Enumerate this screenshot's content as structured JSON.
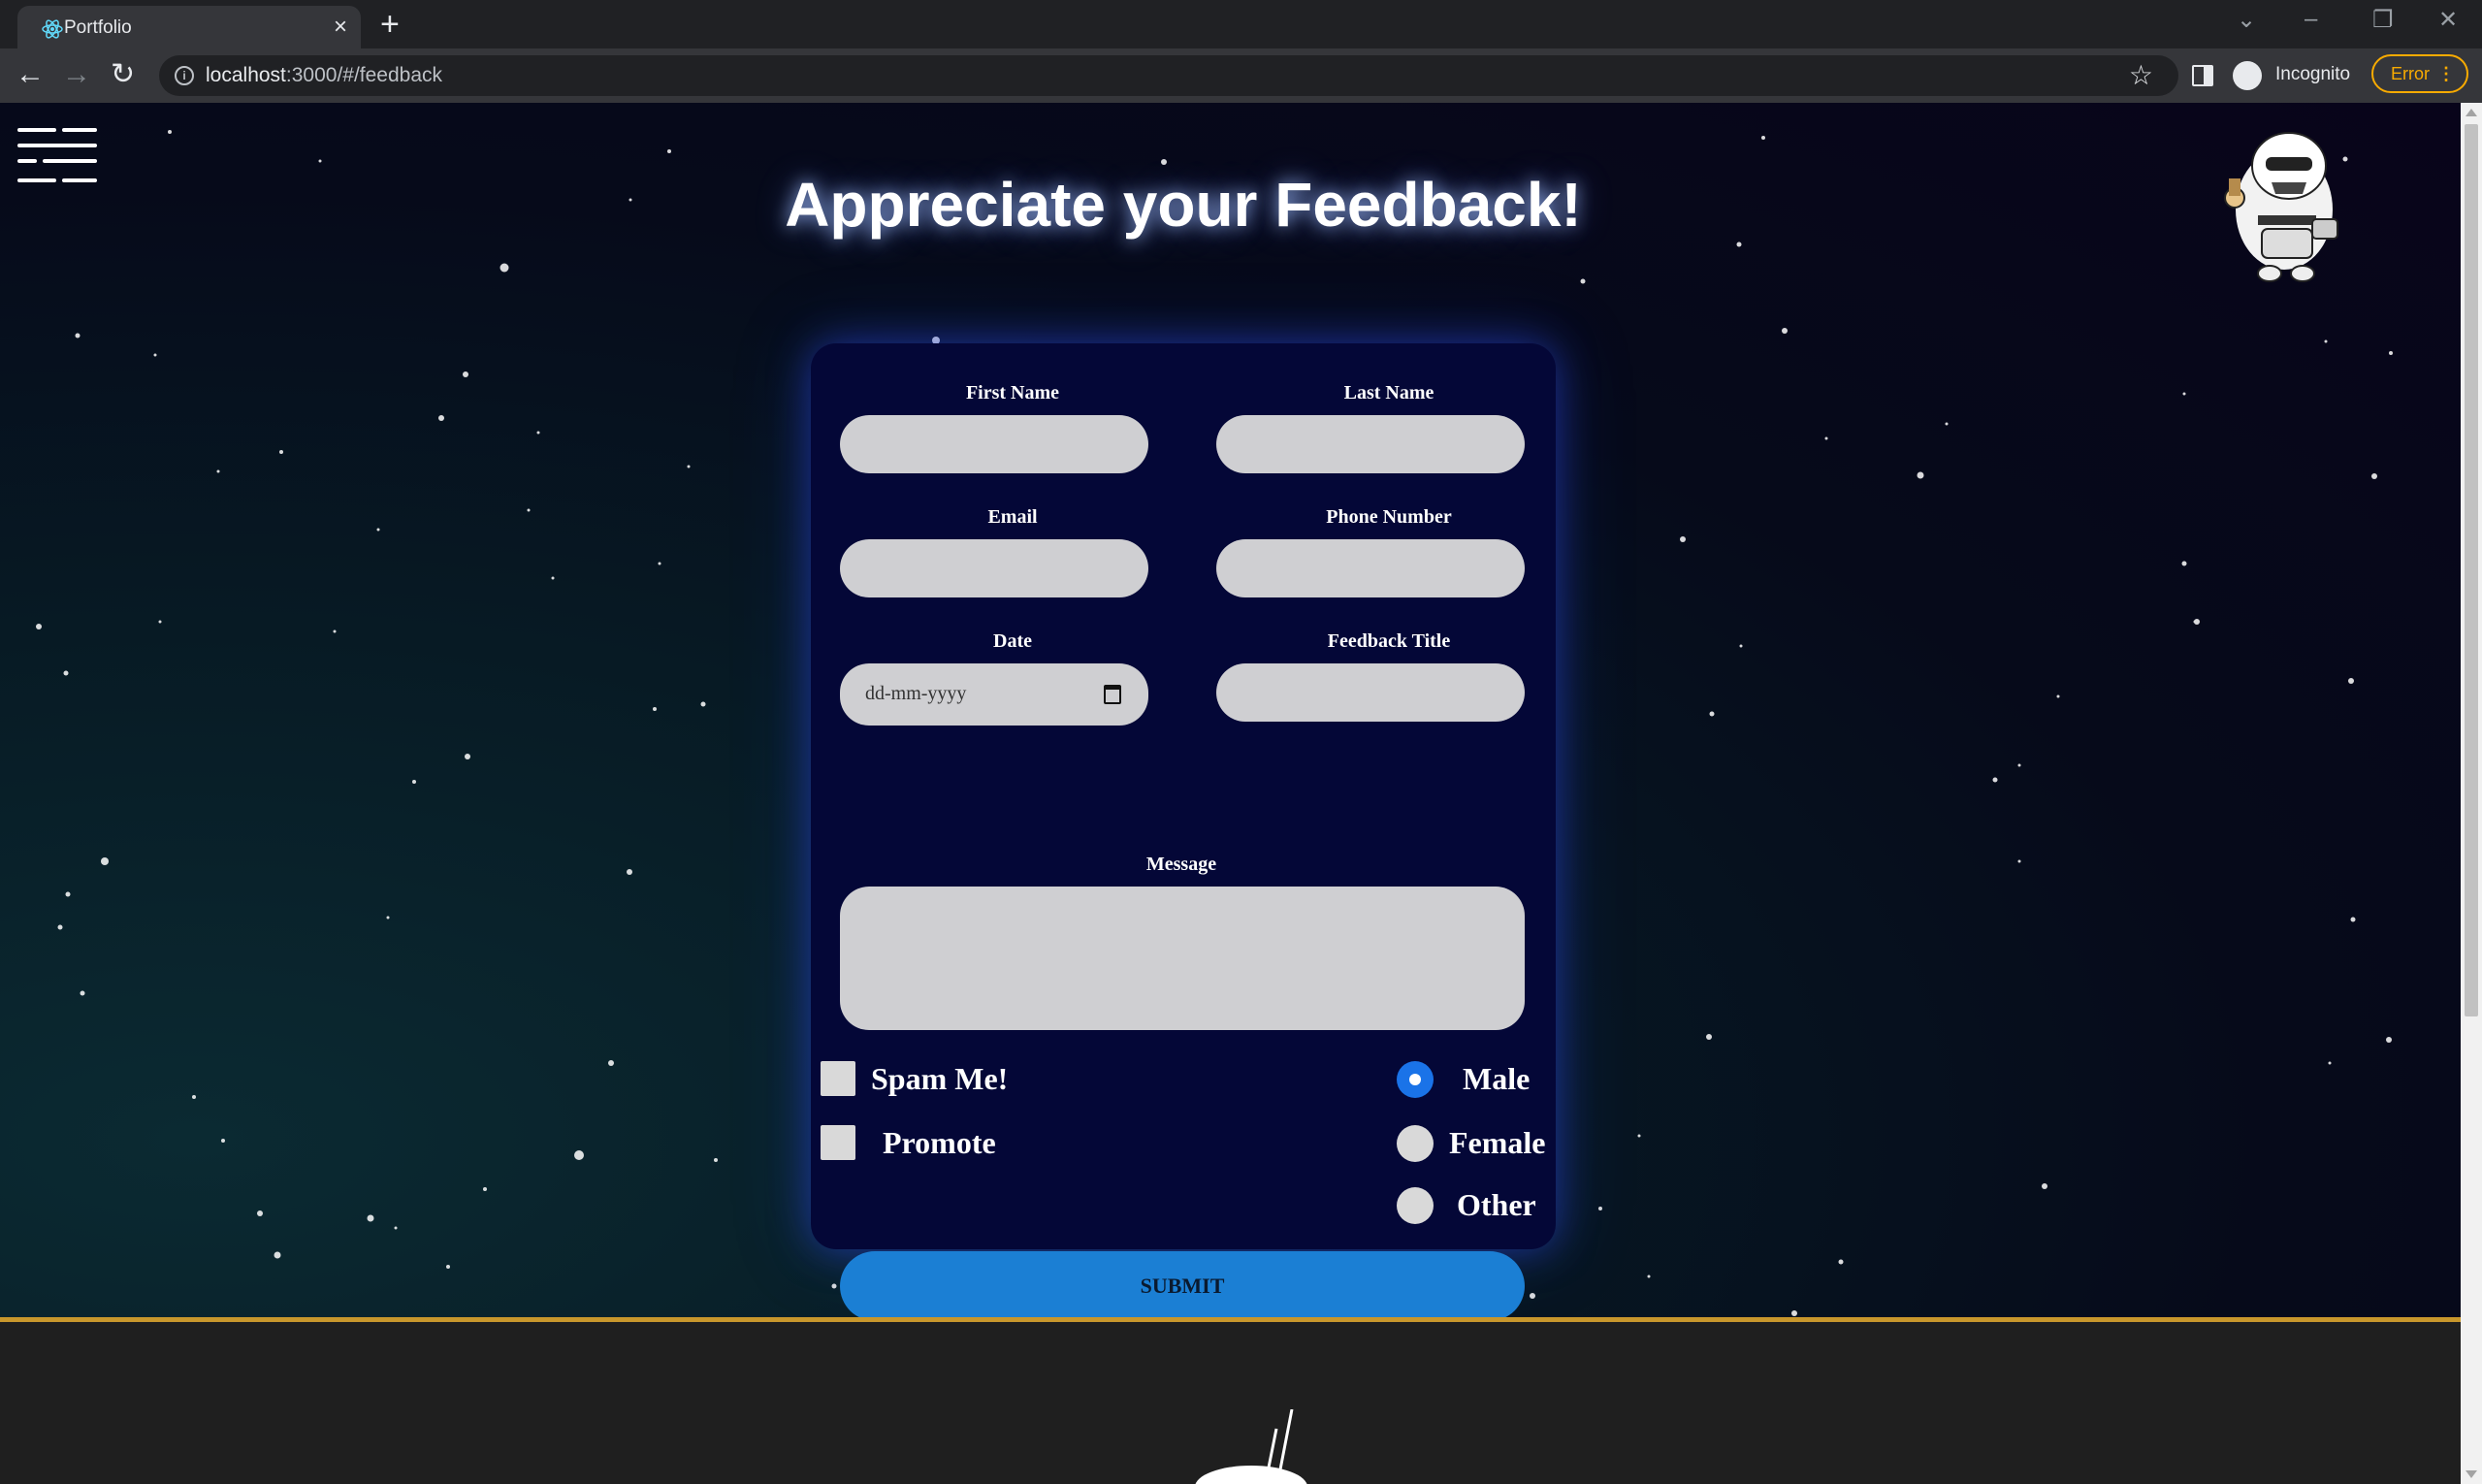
{
  "browser": {
    "tab_title": "Portfolio",
    "tab_favicon": "react-atom-icon",
    "tab_close": "×",
    "new_tab": "+",
    "url_host": "localhost",
    "url_path": ":3000/#/feedback",
    "incognito_label": "Incognito",
    "error_label": "Error"
  },
  "page": {
    "title": "Appreciate your Feedback!",
    "menu_icon": "hamburger-menu-icon",
    "mascot": "stormtrooper-mascot-image"
  },
  "form": {
    "first_name_label": "First Name",
    "last_name_label": "Last Name",
    "email_label": "Email",
    "phone_label": "Phone Number",
    "date_label": "Date",
    "date_placeholder": "dd-mm-yyyy",
    "feedback_title_label": "Feedback Title",
    "message_label": "Message",
    "checkboxes": [
      {
        "label": "Spam Me!",
        "checked": false
      },
      {
        "label": "Promote",
        "checked": false
      }
    ],
    "gender_options": [
      {
        "label": "Male",
        "checked": true
      },
      {
        "label": "Female",
        "checked": false
      },
      {
        "label": "Other",
        "checked": false
      }
    ],
    "submit_label": "SUBMIT"
  },
  "colors": {
    "card_bg": "#040737",
    "accent_blue": "#1b7fd4",
    "footer_line": "#c8972c",
    "error_orange": "#f9ab00"
  }
}
